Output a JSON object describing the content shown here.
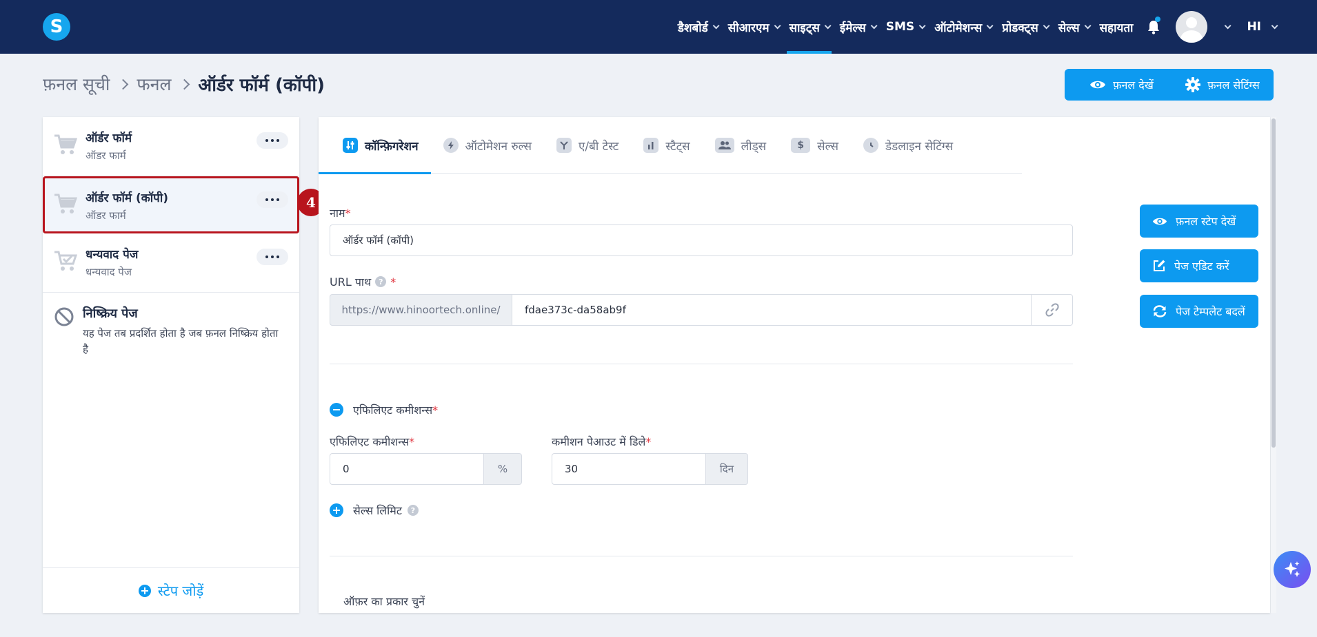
{
  "nav": {
    "logo": "S",
    "items": [
      {
        "label": "डैशबोर्ड",
        "dropdown": true,
        "active": false
      },
      {
        "label": "सीआरएम",
        "dropdown": true,
        "active": false
      },
      {
        "label": "साइट्स",
        "dropdown": true,
        "active": true
      },
      {
        "label": "ईमेल्स",
        "dropdown": true,
        "active": false
      },
      {
        "label": "SMS",
        "dropdown": true,
        "active": false
      },
      {
        "label": "ऑटोमेशन्स",
        "dropdown": true,
        "active": false
      },
      {
        "label": "प्रोडक्ट्स",
        "dropdown": true,
        "active": false
      },
      {
        "label": "सेल्स",
        "dropdown": true,
        "active": false
      },
      {
        "label": "सहायता",
        "dropdown": false,
        "active": false
      }
    ],
    "language": "HI"
  },
  "breadcrumb": {
    "items": [
      "फ़नल सूची",
      "फनल"
    ],
    "current": "ऑर्डर फॉर्म (कॉपी)"
  },
  "header_buttons": {
    "view_funnel": "फ़नल देखें",
    "funnel_settings": "फ़नल सेटिंग्स"
  },
  "steps": [
    {
      "title": "ऑर्डर फॉर्म",
      "subtitle": "ऑडर फार्म",
      "selected": false
    },
    {
      "title": "ऑर्डर फॉर्म (कॉपी)",
      "subtitle": "ऑडर फार्म",
      "selected": true
    },
    {
      "title": "धन्यवाद पेज",
      "subtitle": "धन्यवाद पेज",
      "selected": false
    }
  ],
  "inactive_page": {
    "title": "निष्क्रिय पेज",
    "description": "यह पेज तब प्रदर्शित होता है जब फ़नल निष्क्रिय होता है"
  },
  "add_step": "स्टेप जोड़ें",
  "annotation_badge": "4",
  "tabs": [
    {
      "label": "कॉन्फ़िगरेशन",
      "icon": "sliders-icon",
      "active": true
    },
    {
      "label": "ऑटोमेशन रुल्स",
      "icon": "bolt-icon",
      "active": false
    },
    {
      "label": "ए/बी टेस्ट",
      "icon": "split-icon",
      "active": false
    },
    {
      "label": "स्टैट्स",
      "icon": "bar-chart-icon",
      "active": false
    },
    {
      "label": "लीड्स",
      "icon": "users-icon",
      "active": false
    },
    {
      "label": "सेल्स",
      "icon": "dollar-icon",
      "active": false
    },
    {
      "label": "डेडलाइन सेटिंग्स",
      "icon": "clock-icon",
      "active": false
    }
  ],
  "form": {
    "name_label": "नाम",
    "name_value": "ऑर्डर फॉर्म (कॉपी)",
    "url_label": "URL पाथ",
    "url_prefix": "https://www.hinoortech.online/",
    "url_value": "fdae373c-da58ab9f",
    "affiliate_section": "एफिलिएट कमीशन्स",
    "affiliate_label": "एफिलिएट कमीशन्स",
    "affiliate_value": "0",
    "affiliate_unit": "%",
    "payout_label": "कमीशन पेआउट में डिले",
    "payout_value": "30",
    "payout_unit": "दिन",
    "sales_limit": "सेल्स लिमिट",
    "offer_type_label": "ऑफ़र का प्रकार चुनें",
    "required_mark": "*",
    "help_mark": "?"
  },
  "side_buttons": {
    "view_step": "फ़नल स्टेप देखें",
    "edit_page": "पेज एडिट करें",
    "change_template": "पेज टेम्पलेट बदलें"
  },
  "colors": {
    "navbar": "#142a5c",
    "accent": "#0d9af0",
    "highlight": "#b8141d"
  }
}
